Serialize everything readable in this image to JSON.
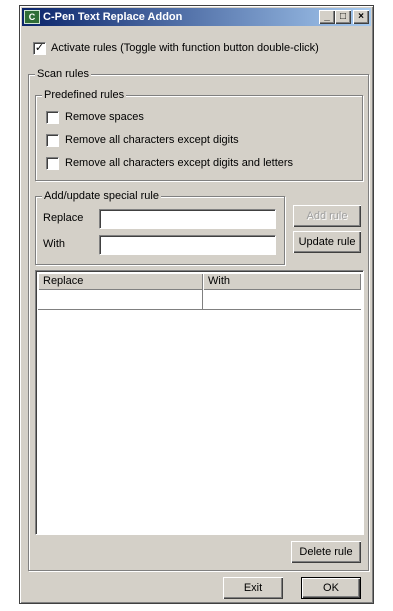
{
  "window": {
    "title": "C-Pen Text Replace Addon",
    "minimize_glyph": "_",
    "maximize_glyph": "□",
    "close_glyph": "×",
    "app_icon": "c-pen-app-icon"
  },
  "activate": {
    "checked": true,
    "label": "Activate rules (Toggle with function button double-click)"
  },
  "scan_rules": {
    "legend": "Scan rules",
    "predefined": {
      "legend": "Predefined rules",
      "items": [
        {
          "label": "Remove spaces",
          "checked": false
        },
        {
          "label": "Remove all characters except digits",
          "checked": false
        },
        {
          "label": "Remove all characters except digits and letters",
          "checked": false
        }
      ]
    },
    "special": {
      "legend": "Add/update special rule",
      "replace_label": "Replace",
      "replace_value": "",
      "with_label": "With",
      "with_value": "",
      "add_button": "Add rule",
      "update_button": "Update rule"
    },
    "table": {
      "columns": [
        "Replace",
        "With"
      ],
      "rows": [
        [
          "",
          ""
        ]
      ]
    },
    "delete_button": "Delete rule"
  },
  "footer": {
    "exit_button": "Exit",
    "ok_button": "OK"
  }
}
